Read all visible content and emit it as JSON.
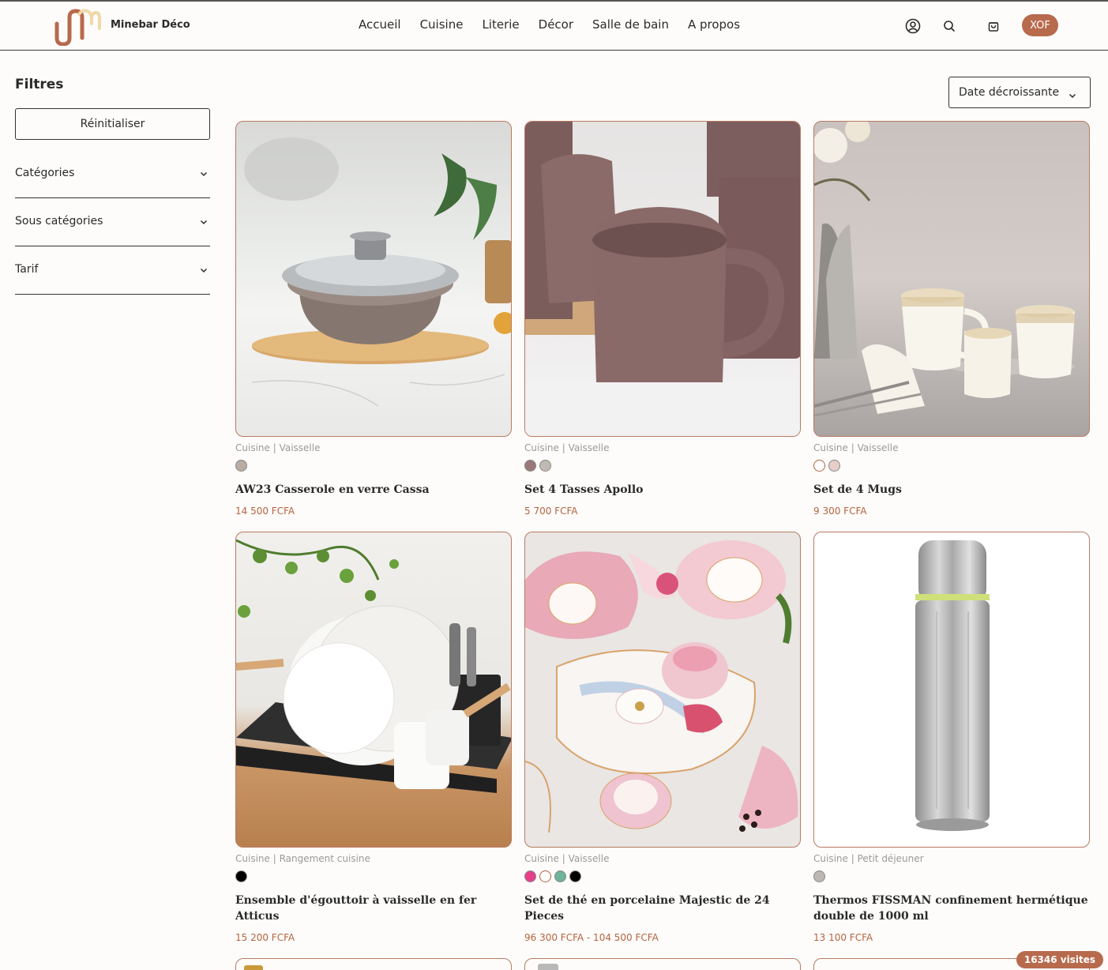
{
  "header": {
    "brand": "Minebar Déco",
    "nav": [
      "Accueil",
      "Cuisine",
      "Literie",
      "Décor",
      "Salle de bain",
      "A propos"
    ],
    "icons": [
      "user-icon",
      "search-icon",
      "cart-icon"
    ],
    "currency": "XOF",
    "accent_color": "#b86a4d"
  },
  "sidebar": {
    "title": "Filtres",
    "reset_label": "Réinitialiser",
    "filters": [
      "Catégories",
      "Sous catégories",
      "Tarif"
    ]
  },
  "sort": {
    "selected": "Date décroissante"
  },
  "products": [
    {
      "category": "Cuisine | Vaisselle",
      "title": "AW23 Casserole en verre Cassa",
      "price": "14 500 FCFA",
      "swatches": [
        "#b8aca5"
      ]
    },
    {
      "category": "Cuisine | Vaisselle",
      "title": "Set 4 Tasses Apollo",
      "price": "5 700 FCFA",
      "swatches": [
        "#9b7878",
        "#bfbab2"
      ]
    },
    {
      "category": "Cuisine | Vaisselle",
      "title": "Set de 4 Mugs",
      "price": "9 300 FCFA",
      "swatches": [
        "#ffffff",
        "#e6cfcb"
      ]
    },
    {
      "category": "Cuisine | Rangement cuisine",
      "title": "Ensemble d'égouttoir à vaisselle en fer Atticus",
      "price": "15 200 FCFA",
      "swatches": [
        "#000000"
      ]
    },
    {
      "category": "Cuisine | Vaisselle",
      "title": "Set de thé en porcelaine Majestic de 24 Pieces",
      "price": "96 300 FCFA - 104 500 FCFA",
      "swatches": [
        "#e6408a",
        "#ffffff",
        "#6eb39a",
        "#000000"
      ]
    },
    {
      "category": "Cuisine | Petit déjeuner",
      "title": "Thermos FISSMAN confinement hermétique double de 1000 ml",
      "price": "13 100 FCFA",
      "swatches": [
        "#bdb8b4"
      ]
    }
  ],
  "visits_badge": "16346 visites"
}
